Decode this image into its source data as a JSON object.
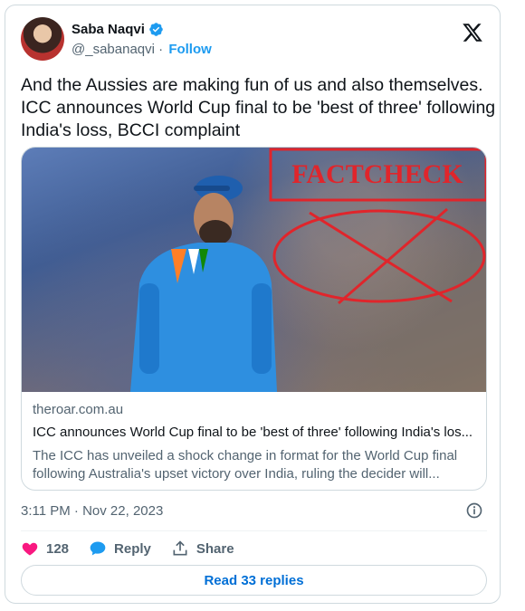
{
  "author": {
    "name": "Saba Naqvi",
    "handle": "@_sabanaqvi",
    "follow_label": "Follow",
    "verified": true
  },
  "tweet": {
    "text": "And the Aussies are making fun of us and also themselves. ICC announces World Cup final to be 'best of three' following India's loss, BCCI complaint"
  },
  "media_overlay": {
    "stamp_text": "FACTCHECK",
    "stamp_color": "#e0252b"
  },
  "link_card": {
    "domain": "theroar.com.au",
    "title": "ICC announces World Cup final to be 'best of three' following India's los...",
    "description": "The ICC has unveiled a shock change in format for the World Cup final following Australia's upset victory over India, ruling the decider will..."
  },
  "timestamp": "3:11 PM · Nov 22, 2023",
  "actions": {
    "likes": "128",
    "reply_label": "Reply",
    "share_label": "Share"
  },
  "read_replies_label": "Read 33 replies",
  "colors": {
    "accent": "#1d9bf0",
    "like": "#f91880",
    "link_blue": "#006fd6"
  }
}
